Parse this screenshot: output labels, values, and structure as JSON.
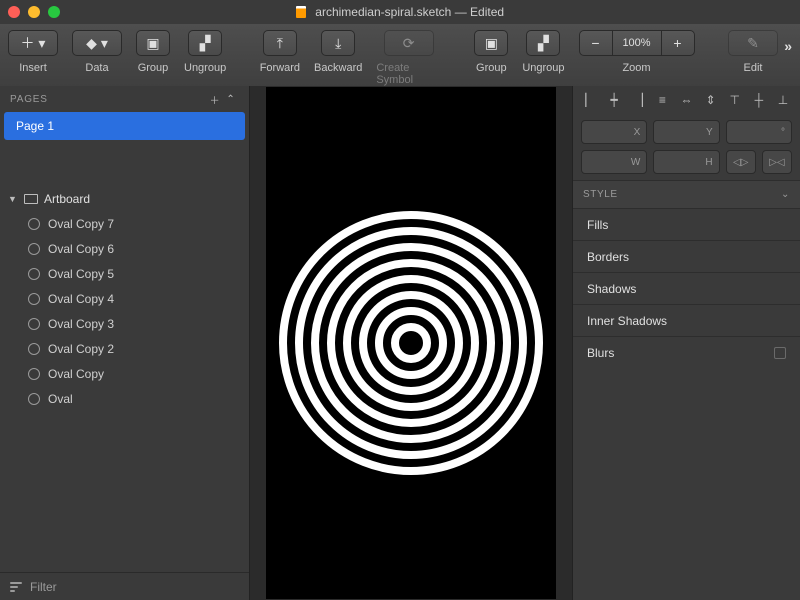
{
  "titlebar": {
    "filename": "archimedian-spiral.sketch",
    "state": "Edited"
  },
  "toolbar": {
    "insert": "Insert",
    "data": "Data",
    "group": "Group",
    "ungroup": "Ungroup",
    "forward": "Forward",
    "backward": "Backward",
    "create_symbol": "Create Symbol",
    "group2": "Group",
    "ungroup2": "Ungroup",
    "zoom": "Zoom",
    "zoom_value": "100%",
    "edit": "Edit"
  },
  "pages": {
    "header": "PAGES",
    "items": [
      {
        "name": "Page 1"
      }
    ]
  },
  "layers": {
    "artboard": "Artboard",
    "children": [
      "Oval Copy 7",
      "Oval Copy 6",
      "Oval Copy 5",
      "Oval Copy 4",
      "Oval Copy 3",
      "Oval Copy 2",
      "Oval Copy",
      "Oval"
    ]
  },
  "filter_label": "Filter",
  "inspector": {
    "x": "X",
    "y": "Y",
    "deg": "°",
    "w": "W",
    "h": "H",
    "style": "STYLE",
    "sections": [
      "Fills",
      "Borders",
      "Shadows",
      "Inner Shadows",
      "Blurs"
    ]
  },
  "canvas": {
    "ring_radii": [
      16,
      32,
      48,
      64,
      80,
      96,
      112,
      128
    ],
    "stroke": 8
  }
}
